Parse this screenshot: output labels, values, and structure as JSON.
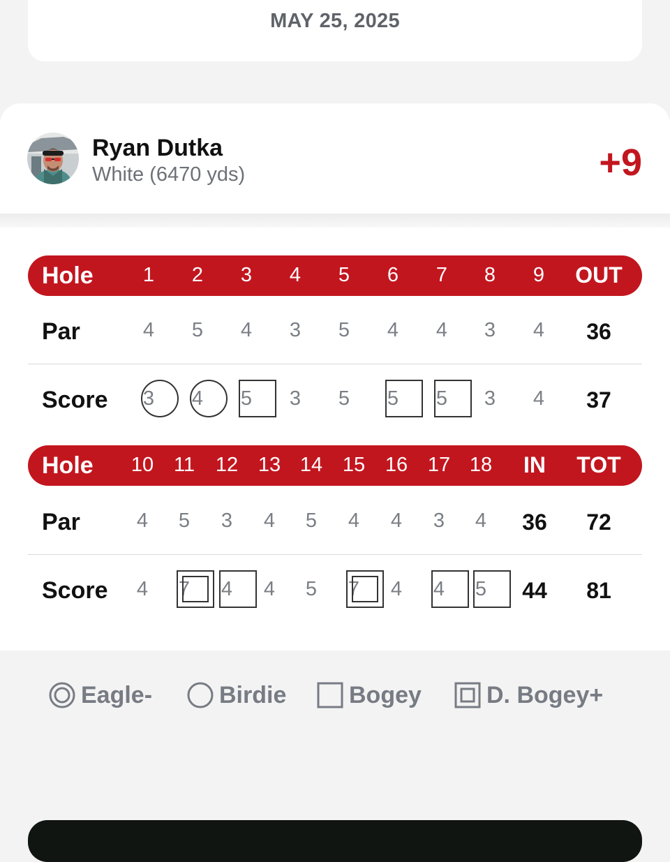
{
  "date": "MAY 25, 2025",
  "player": {
    "name": "Ryan Dutka",
    "tee": "White (6470 yds)",
    "score_to_par": "+9"
  },
  "front_nine": {
    "hole_label": "Hole",
    "holes": [
      "1",
      "2",
      "3",
      "4",
      "5",
      "6",
      "7",
      "8",
      "9"
    ],
    "total_label": "OUT",
    "par_label": "Par",
    "par": [
      "4",
      "5",
      "4",
      "3",
      "5",
      "4",
      "4",
      "3",
      "4"
    ],
    "par_total": "36",
    "score_label": "Score",
    "score": [
      "3",
      "4",
      "5",
      "3",
      "5",
      "5",
      "5",
      "3",
      "4"
    ],
    "score_marks": [
      "circle",
      "circle",
      "square",
      "none",
      "none",
      "square",
      "square",
      "none",
      "none"
    ],
    "score_total": "37"
  },
  "back_nine": {
    "hole_label": "Hole",
    "holes": [
      "10",
      "11",
      "12",
      "13",
      "14",
      "15",
      "16",
      "17",
      "18"
    ],
    "in_label": "IN",
    "tot_label": "TOT",
    "par_label": "Par",
    "par": [
      "4",
      "5",
      "3",
      "4",
      "5",
      "4",
      "4",
      "3",
      "4"
    ],
    "par_in": "36",
    "par_tot": "72",
    "score_label": "Score",
    "score": [
      "4",
      "7",
      "4",
      "4",
      "5",
      "7",
      "4",
      "4",
      "5"
    ],
    "score_marks": [
      "none",
      "dsquare",
      "square",
      "none",
      "none",
      "dsquare",
      "none",
      "square",
      "square"
    ],
    "score_in": "44",
    "score_tot": "81"
  },
  "legend": {
    "eagle": "Eagle-",
    "birdie": "Birdie",
    "bogey": "Bogey",
    "dbogey": "D. Bogey+"
  },
  "colors": {
    "accent": "#c2161f",
    "muted_text": "#7b7f85",
    "background": "#f3f3f3"
  }
}
